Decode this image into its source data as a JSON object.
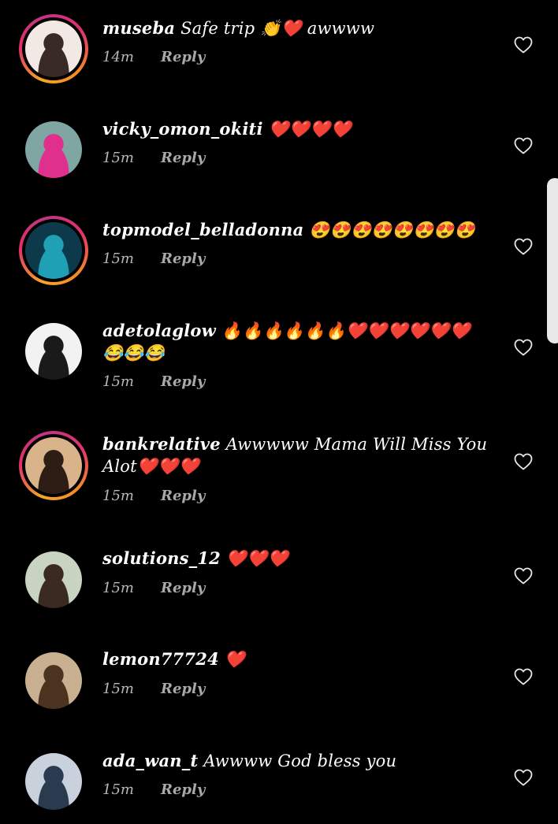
{
  "comments": [
    {
      "username": "museba",
      "message": "Safe trip 👏❤️ awwww",
      "time": "14m",
      "reply": "Reply",
      "ring": true,
      "avatar_colors": [
        "#f3e9e4",
        "#3a2a25"
      ]
    },
    {
      "username": "vicky_omon_okiti",
      "message": "❤️❤️❤️❤️",
      "time": "15m",
      "reply": "Reply",
      "ring": false,
      "avatar_colors": [
        "#7fa6a3",
        "#e0308e"
      ]
    },
    {
      "username": "topmodel_belladonna",
      "message": "😍😍😍😍😍😍😍😍",
      "time": "15m",
      "reply": "Reply",
      "ring": true,
      "avatar_colors": [
        "#0d3a4a",
        "#1fa0b5"
      ]
    },
    {
      "username": "adetolaglow",
      "message": "🔥🔥🔥🔥🔥🔥❤️❤️❤️❤️❤️❤️😂😂😂",
      "time": "15m",
      "reply": "Reply",
      "ring": false,
      "avatar_colors": [
        "#f2f2f2",
        "#1a1a1a"
      ]
    },
    {
      "username": "bankrelative",
      "message": "Awwwww Mama Will Miss You Alot❤️❤️❤️",
      "time": "15m",
      "reply": "Reply",
      "ring": true,
      "avatar_colors": [
        "#d9b48a",
        "#2d1d15"
      ]
    },
    {
      "username": "solutions_12",
      "message": "❤️❤️❤️",
      "time": "15m",
      "reply": "Reply",
      "ring": false,
      "avatar_colors": [
        "#c8d3c2",
        "#3a2a22"
      ]
    },
    {
      "username": "lemon77724",
      "message": "❤️",
      "time": "15m",
      "reply": "Reply",
      "ring": false,
      "avatar_colors": [
        "#c8b090",
        "#4a3420"
      ]
    },
    {
      "username": "ada_wan_t",
      "message": "Awwww God bless you",
      "time": "15m",
      "reply": "Reply",
      "ring": false,
      "avatar_colors": [
        "#c9d2dc",
        "#2a3a4f"
      ]
    }
  ],
  "colors": {
    "background": "#000000",
    "text": "#ffffff",
    "meta": "#b8b8b8",
    "heart": "#e8e8e8"
  },
  "icons": {
    "like": "heart-outline-icon"
  }
}
